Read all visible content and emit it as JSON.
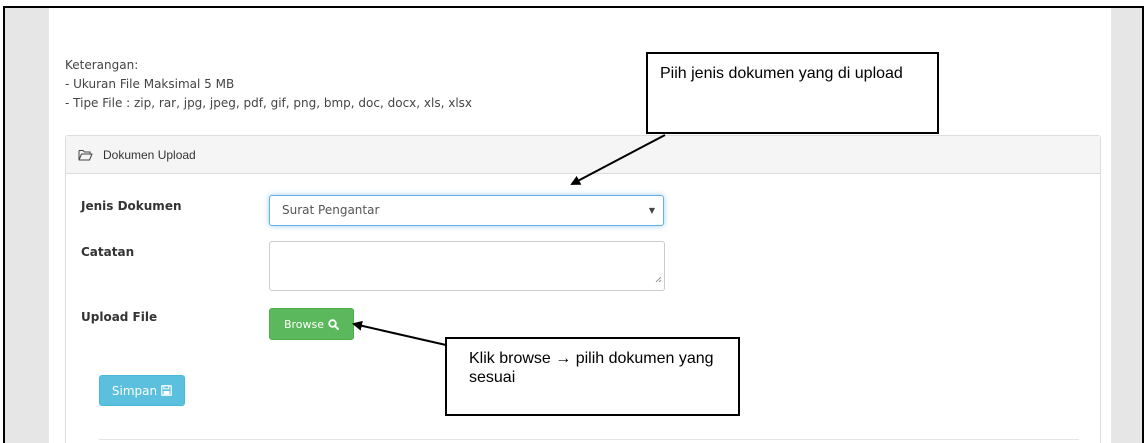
{
  "info": {
    "heading": "Keterangan:",
    "line1": "- Ukuran File Maksimal 5 MB",
    "line2": "- Tipe File : zip, rar, jpg, jpeg, pdf, gif, png, bmp, doc, docx, xls, xlsx"
  },
  "panel": {
    "title": "Dokumen Upload",
    "icon": "folder-open-icon"
  },
  "form": {
    "jenis_label": "Jenis Dokumen",
    "jenis_value": "Surat Pengantar",
    "catatan_label": "Catatan",
    "catatan_value": "",
    "upload_label": "Upload File",
    "browse_label": "Browse",
    "browse_icon": "search-icon",
    "save_label": "Simpan",
    "save_icon": "floppy-disk-icon"
  },
  "callouts": {
    "top_text": "Piih jenis dokumen yang di upload",
    "bottom_text": "Klik browse → pilih dokumen yang sesuai"
  },
  "colors": {
    "browse_button": "#5cb85c",
    "save_button": "#5bc0de",
    "select_focus": "#66afe9"
  }
}
